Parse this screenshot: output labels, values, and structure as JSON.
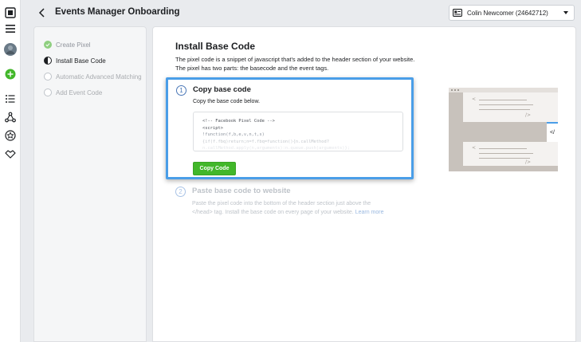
{
  "header": {
    "title": "Events Manager Onboarding",
    "account_label": "Colin Newcomer (24642712)"
  },
  "rail": {
    "icons": [
      "grid-icon",
      "menu-icon",
      "avatar",
      "add-icon",
      "list-icon",
      "network-icon",
      "star-icon",
      "partner-icon"
    ]
  },
  "steps": [
    {
      "label": "Create Pixel",
      "state": "done"
    },
    {
      "label": "Install Base Code",
      "state": "active"
    },
    {
      "label": "Automatic Advanced Matching",
      "state": "todo"
    },
    {
      "label": "Add Event Code",
      "state": "todo"
    }
  ],
  "main": {
    "title": "Install Base Code",
    "description_line1": "The pixel code is a snippet of javascript that's added to the header section of your website.",
    "description_line2": "The pixel has two parts: the basecode and the event tags.",
    "step1": {
      "number": "1",
      "title": "Copy base code",
      "subtitle": "Copy the base code below.",
      "code_lines": [
        "<!-- Facebook Pixel Code -->",
        "<script>",
        "!function(f,b,e,v,n,t,s)",
        "{if(f.fbq)return;n=f.fbq=function(){n.callMethod?",
        "n.callMethod.apply(n,arguments):n.queue.push(arguments)};"
      ],
      "button_label": "Copy Code"
    },
    "step2": {
      "number": "2",
      "title": "Paste base code to website",
      "description_line1": "Paste the pixel code into the bottom of the header section just above the",
      "description_line2": "</head> tag. Install the base code on every page of your website.",
      "learn_more": "Learn more"
    }
  },
  "illustration": {
    "tag_text": "</>",
    "code_badge": "</"
  },
  "colors": {
    "accent_blue": "#4a9ee8",
    "button_green": "#42b72a",
    "done_green": "#8fcf80"
  }
}
